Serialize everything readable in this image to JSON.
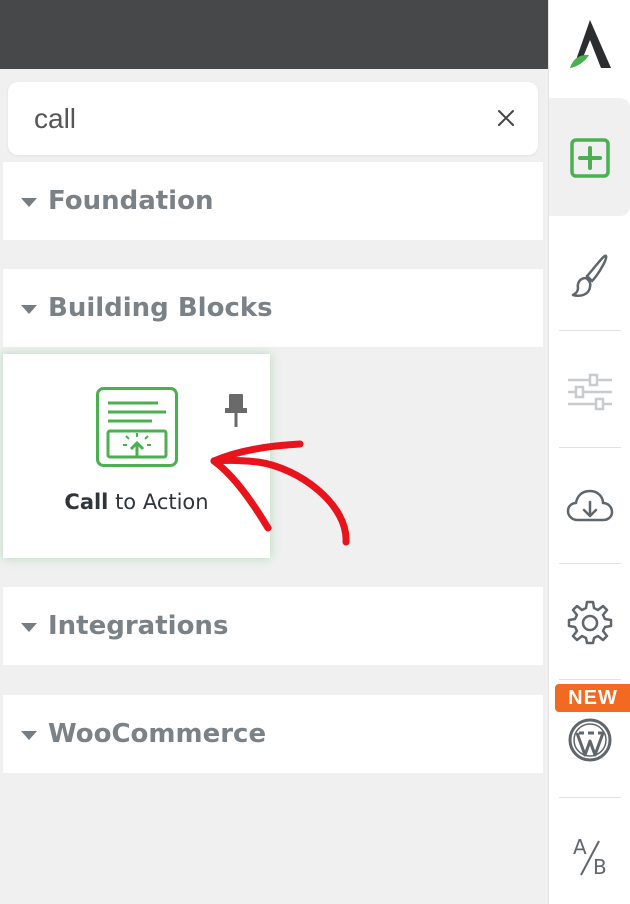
{
  "search": {
    "value": "call",
    "clear_icon": "close-icon"
  },
  "sections": [
    {
      "label": "Foundation"
    },
    {
      "label": "Building Blocks"
    },
    {
      "label": "Integrations"
    },
    {
      "label": "WooCommerce"
    }
  ],
  "result_card": {
    "title_bold": "Call",
    "title_rest": " to Action",
    "icon": "call-to-action-icon",
    "pin_icon": "pin-icon"
  },
  "rail": {
    "items": [
      {
        "name": "logo",
        "icon": "thrive-logo-icon"
      },
      {
        "name": "add-element",
        "icon": "plus-square-icon",
        "active": true
      },
      {
        "name": "styles",
        "icon": "paintbrush-icon"
      },
      {
        "name": "settings-sliders",
        "icon": "sliders-icon"
      },
      {
        "name": "cloud-templates",
        "icon": "cloud-download-icon"
      },
      {
        "name": "settings",
        "icon": "gear-icon"
      },
      {
        "name": "wordpress",
        "icon": "wordpress-icon"
      },
      {
        "name": "ab-test",
        "icon": "ab-test-icon"
      }
    ],
    "new_badge": "NEW",
    "ab_a": "A",
    "ab_b": "B"
  },
  "colors": {
    "accent_green": "#4caf50",
    "badge_orange": "#f26a21",
    "annotation_red": "#e8131b",
    "topbar": "#464849"
  }
}
